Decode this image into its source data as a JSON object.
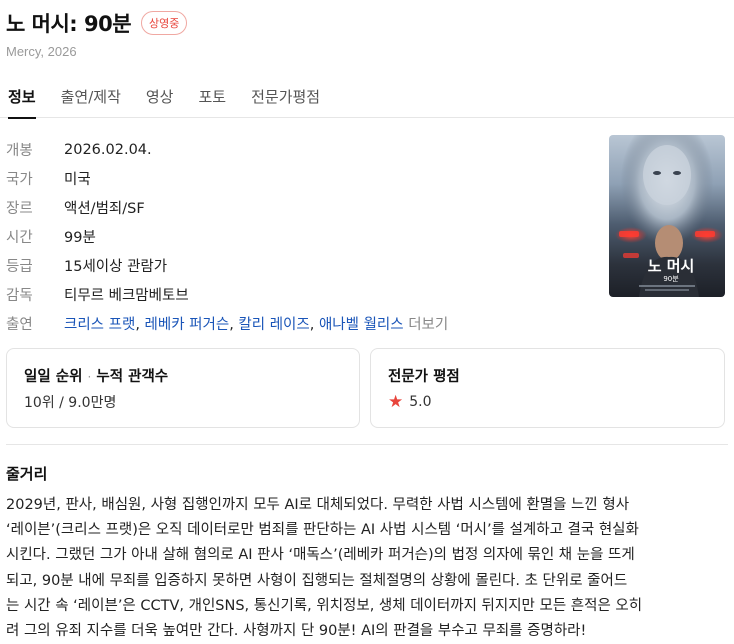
{
  "header": {
    "title": "노 머시: 90분",
    "badge": "상영중",
    "subtitle": "Mercy, 2026"
  },
  "tabs": [
    "정보",
    "출연/제작",
    "영상",
    "포토",
    "전문가평점"
  ],
  "info": {
    "release": {
      "label": "개봉",
      "value": "2026.02.04."
    },
    "country": {
      "label": "국가",
      "value": "미국"
    },
    "genre": {
      "label": "장르",
      "value": "액션/범죄/SF"
    },
    "runtime": {
      "label": "시간",
      "value": "99분"
    },
    "rating": {
      "label": "등급",
      "value": "15세이상 관람가"
    },
    "director": {
      "label": "감독",
      "value": "티무르 베크맘베토브"
    },
    "cast": {
      "label": "출연",
      "names": [
        "크리스 프랫",
        "레베카 퍼거슨",
        "칼리 레이즈",
        "애나벨 월리스"
      ],
      "more": "더보기"
    }
  },
  "cards": {
    "box_office": {
      "title_a": "일일 순위",
      "dot": "·",
      "title_b": "누적 관객수",
      "value": "10위 / 9.0만명"
    },
    "critic": {
      "title": "전문가 평점",
      "score": "5.0"
    }
  },
  "synopsis": {
    "title": "줄거리",
    "lines": [
      "2029년, 판사, 배심원, 사형 집행인까지 모두 AI로 대체되었다. 무력한 사법 시스템에 환멸을 느낀 형사",
      "‘레이븐’(크리스 프랫)은 오직 데이터로만 범죄를 판단하는 AI 사법 시스템 ‘머시’를 설계하고 결국 현실화",
      "시킨다. 그랬던 그가 아내 살해 혐의로 AI 판사 ‘매독스’(레베카 퍼거슨)의 법정 의자에 묶인 채 눈을 뜨게",
      "되고, 90분 내에 무죄를 입증하지 못하면 사형이 집행되는 절체절명의 상황에 몰린다. 초 단위로 줄어드",
      "는 시간 속 ‘레이븐’은 CCTV, 개인SNS, 통신기록, 위치정보, 생체 데이터까지 뒤지지만 모든 흔적은 오히",
      "려 그의 유죄 지수를 더욱 높여만 간다. 사형까지 단 90분! AI의 판결을 부수고 무죄를 증명하라!"
    ]
  },
  "poster": {
    "title_text": "노 머시",
    "subtitle_text": "90분"
  },
  "colors": {
    "accent": "#e8453c",
    "link": "#1a55b8"
  }
}
